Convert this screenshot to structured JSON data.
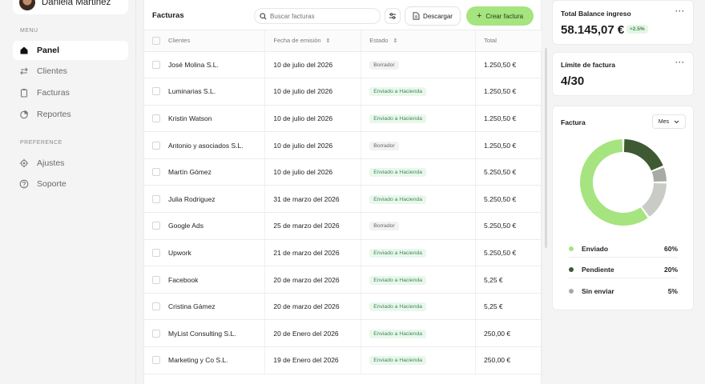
{
  "user": {
    "name": "Daniela Martinez"
  },
  "sidebar": {
    "menu_label": "MENU",
    "preference_label": "PREFERENCE",
    "items": [
      {
        "label": "Panel",
        "icon": "home-icon",
        "active": true
      },
      {
        "label": "Clientes",
        "icon": "swap-icon"
      },
      {
        "label": "Facturas",
        "icon": "clipboard-icon"
      },
      {
        "label": "Reportes",
        "icon": "pie-chart-icon"
      }
    ],
    "pref_items": [
      {
        "label": "Ajustes",
        "icon": "gear-icon"
      },
      {
        "label": "Soporte",
        "icon": "help-icon"
      }
    ]
  },
  "toolbar": {
    "title": "Facturas",
    "search_placeholder": "Buscar facturas",
    "download_label": "Descargar",
    "create_label": "Crear factura"
  },
  "table": {
    "headers": {
      "client": "Clientes",
      "date": "Fecha de emisión",
      "status": "Estado",
      "total": "Total"
    },
    "rows": [
      {
        "client": "José Molina S.L.",
        "date": "10 de julio del 2026",
        "status": "Borrador",
        "kind": "draft",
        "total": "1.250,50 €"
      },
      {
        "client": "Luminarias S.L.",
        "date": "10 de julio del 2026",
        "status": "Enviado a Hacienda",
        "kind": "sent",
        "total": "1.250,50 €"
      },
      {
        "client": "Kristin Watson",
        "date": "10 de julio del 2026",
        "status": "Enviado a Hacienda",
        "kind": "sent",
        "total": "1.250,50 €"
      },
      {
        "client": "Antonio y asociados S.L.",
        "date": "10 de julio del 2026",
        "status": "Borrador",
        "kind": "draft",
        "total": "1.250,50 €"
      },
      {
        "client": "Martín Gómez",
        "date": "10 de julio del 2026",
        "status": "Enviado a Hacienda",
        "kind": "sent",
        "total": "5.250,50 €"
      },
      {
        "client": "Julia Rodriguez",
        "date": "31 de marzo del 2026",
        "status": "Enviado a Hacienda",
        "kind": "sent",
        "total": "5.250,50 €"
      },
      {
        "client": "Google Ads",
        "date": "25 de marzo del 2026",
        "status": "Borrador",
        "kind": "draft",
        "total": "5.250,50 €"
      },
      {
        "client": "Upwork",
        "date": "21 de marzo del 2026",
        "status": "Enviado a Hacienda",
        "kind": "sent",
        "total": "5.250,50 €"
      },
      {
        "client": "Facebook",
        "date": "20 de marzo del 2026",
        "status": "Enviado a Hacienda",
        "kind": "sent",
        "total": "5,25 €"
      },
      {
        "client": "Cristina Gámez",
        "date": "20 de marzo del 2026",
        "status": "Enviado a Hacienda",
        "kind": "sent",
        "total": "5,25 €"
      },
      {
        "client": "MyList Consulting S.L.",
        "date": "20 de Enero del 2026",
        "status": "Enviado a Hacienda",
        "kind": "sent",
        "total": "250,00 €"
      },
      {
        "client": "Marketing y Co S.L.",
        "date": "19 de Enero del 2026",
        "status": "Enviado a Hacienda",
        "kind": "sent",
        "total": "250,00 €"
      }
    ]
  },
  "balance": {
    "title": "Total Balance ingreso",
    "value": "58.145,07 €",
    "delta": "+2.5%"
  },
  "limit": {
    "title": "Límite de factura",
    "value": "4/30"
  },
  "invoice_chart": {
    "title": "Factura",
    "period": "Mes",
    "colors": {
      "sent": "#a5e47f",
      "pending": "#3f5a32",
      "unsent": "#a8aaa4",
      "unsent_light": "#c9cbc6"
    }
  },
  "chart_data": {
    "type": "pie",
    "categories": [
      "Enviado",
      "Pendiente",
      "Sin enviar"
    ],
    "values": [
      60,
      20,
      5
    ],
    "value_labels": [
      "60%",
      "20%",
      "5%"
    ],
    "title": "Factura"
  }
}
